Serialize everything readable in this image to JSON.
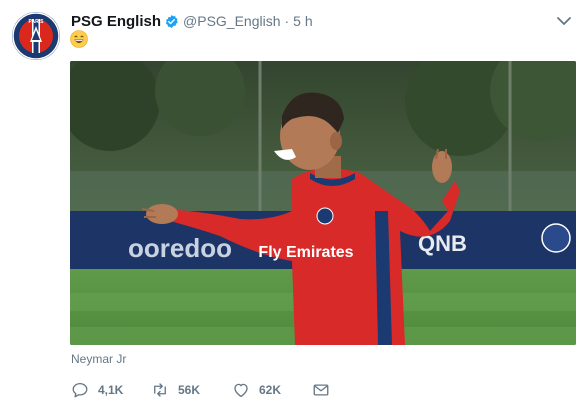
{
  "tweet": {
    "display_name": "PSG English",
    "handle": "@PSG_English",
    "separator": "·",
    "time": "5 h",
    "body_emoji": "grinning-face-emoji",
    "media_caption": "Neymar Jr",
    "media_alt": "PSG player in red training top laughing on pitch",
    "media_banner_text_left": "ooredoo",
    "media_banner_text_right": "QNB",
    "shirt_sponsor": "Fly Emirates",
    "icons": {
      "avatar": "psg-crest-logo",
      "verified": "verified-badge-icon",
      "caret": "chevron-down-icon",
      "reply": "reply-icon",
      "retweet": "retweet-icon",
      "like": "heart-icon",
      "dm": "envelope-icon"
    },
    "actions": {
      "reply_count": "4,1K",
      "retweet_count": "56K",
      "like_count": "62K"
    }
  },
  "colors": {
    "verified_blue": "#1da1f2",
    "psg_navy": "#1b3a72",
    "psg_red": "#da291c",
    "muted_text": "#657786",
    "primary_text": "#14171a"
  }
}
